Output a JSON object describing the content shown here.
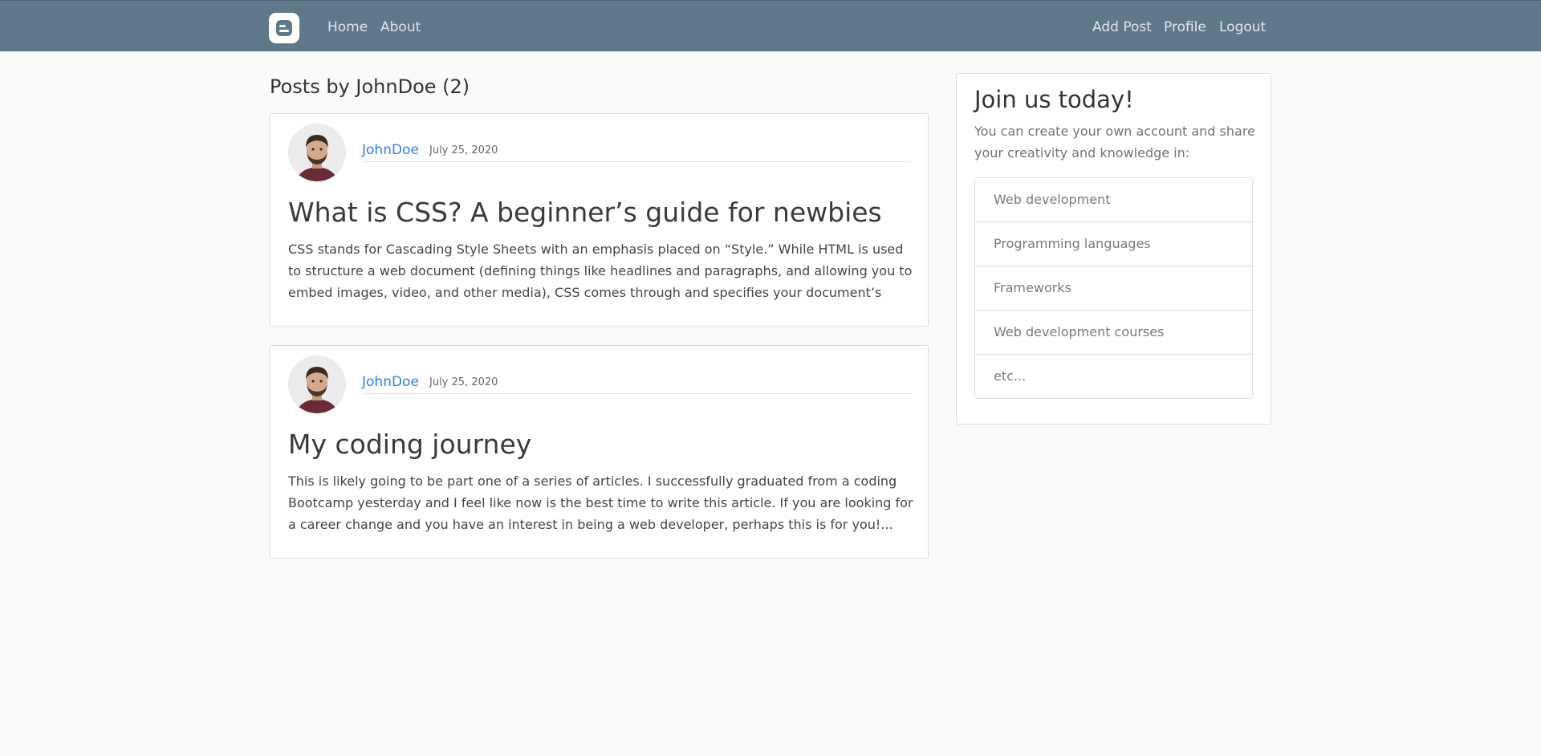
{
  "navbar": {
    "brand_icon": "blogger-b-icon",
    "left_links": [
      {
        "label": "Home"
      },
      {
        "label": "About"
      }
    ],
    "right_links": [
      {
        "label": "Add Post"
      },
      {
        "label": "Profile"
      },
      {
        "label": "Logout"
      }
    ],
    "background": "#5f788a"
  },
  "main": {
    "heading": "Posts by JohnDoe (2)",
    "posts": [
      {
        "author": "JohnDoe",
        "date": "July 25, 2020",
        "title": "What is CSS? A beginner’s guide for newbies",
        "excerpt": "CSS stands for Cascading Style Sheets with an emphasis placed on “Style.” While HTML is used to structure a web document (defining things like headlines and paragraphs, and allowing you to embed images, video, and other media), CSS comes through and specifies your document’s styl...",
        "avatar_icon": "author-avatar"
      },
      {
        "author": "JohnDoe",
        "date": "July 25, 2020",
        "title": "My coding journey",
        "excerpt": "This is likely going to be part one of a series of articles. I successfully graduated from a coding Bootcamp yesterday and I feel like now is the best time to write this article. If you are looking for a career change and you have an interest in being a web developer, perhaps this is for you!...",
        "avatar_icon": "author-avatar"
      }
    ]
  },
  "sidebar": {
    "title": "Join us today!",
    "text": "You can create your own account and share your creativity and knowledge in:",
    "topics": [
      "Web development",
      "Programming languages",
      "Frameworks",
      "Web development courses",
      "etc..."
    ]
  },
  "colors": {
    "page_background": "#fafafa",
    "link": "#2f80ed",
    "card_border": "#dddddd"
  }
}
